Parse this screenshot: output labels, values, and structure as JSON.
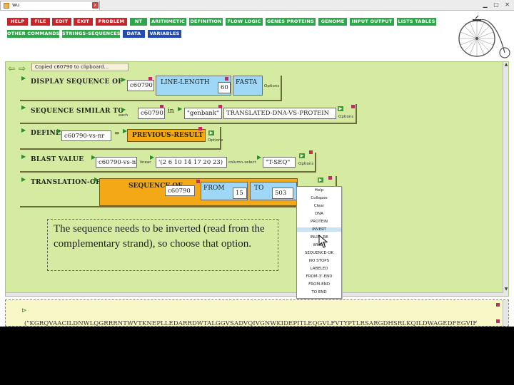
{
  "window": {
    "tab_title": "wu",
    "tab_close": "x"
  },
  "menu": [
    {
      "label": "HELP",
      "color": "#c9262b"
    },
    {
      "label": "FILE",
      "color": "#c9262b"
    },
    {
      "label": "EDIT",
      "color": "#c9262b"
    },
    {
      "label": "EXIT",
      "color": "#c9262b"
    },
    {
      "label": "PROBLEM",
      "color": "#c9262b"
    },
    {
      "label": "NT",
      "color": "#2fa64a"
    },
    {
      "label": "ARITHMETIC",
      "color": "#2fa64a"
    },
    {
      "label": "DEFINITION",
      "color": "#2fa64a"
    },
    {
      "label": "FLOW LOGIC",
      "color": "#2fa64a"
    },
    {
      "label": "GENES PROTEINS",
      "color": "#2fa64a"
    },
    {
      "label": "GENOME",
      "color": "#2fa64a"
    },
    {
      "label": "INPUT OUTPUT",
      "color": "#2fa64a"
    },
    {
      "label": "LISTS TABLES",
      "color": "#2fa64a"
    },
    {
      "label": "OTHER COMMANDS",
      "color": "#2fa64a"
    },
    {
      "label": "STRINGS-SEQUENCES",
      "color": "#2fa64a"
    },
    {
      "label": "DATA",
      "color": "#234bb0"
    },
    {
      "label": "VARIABLES",
      "color": "#234bb0"
    }
  ],
  "clipboard": "Copied c60790 to clipboard...",
  "blocks": {
    "display": {
      "label": "DISPLAY SEQUENCE OF",
      "arg": "c60790",
      "keyword": "LINE-LENGTH",
      "line_length": "60",
      "fasta": "FASTA",
      "options": "Options"
    },
    "similar": {
      "label": "SEQUENCE SIMILAR TO",
      "each": "each",
      "arg": "c60790",
      "in": "in",
      "db": "\"genbank\"",
      "mode": "TRANSLATED-DNA-VS-PROTEIN",
      "options": "Options"
    },
    "define": {
      "label": "DEFINE",
      "var": "c60790-vs-nr",
      "eq": "=",
      "value": "PREVIOUS-RESULT",
      "options": "Options"
    },
    "blast": {
      "label": "BLAST VALUE",
      "arg": "c60790-vs-nr",
      "linear": "linear",
      "list": "'(2 6 10 14 17 20 23)",
      "columnsel": "column-select",
      "qstr": "\"T-SEQ\"",
      "options": "Options"
    },
    "translation": {
      "label": "TRANSLATION-OF",
      "seq_label": "SEQUENCE OF",
      "arg": "c60790",
      "from_label": "FROM",
      "from_val": "15",
      "to_label": "TO",
      "to_val": "503"
    }
  },
  "note": "The sequence needs to be inverted (read from the complementary strand), so choose that option.",
  "context_menu": [
    "Help",
    "Collapse",
    "Clear",
    "DNA",
    "PROTEIN",
    "INVERT",
    "INLIN..RE",
    "WHEN",
    "SEQUENCE-OK",
    "NO STOPS",
    "LABELED",
    "FROM-3'-END",
    "FROM-END",
    "TO END"
  ],
  "context_menu_highlight": 5,
  "output": {
    "prompt": "⊳",
    "text": "(\"KGRQVAACILDNWLQGRRRNTWVTKNEPLLEDARRDWTALGGVSADVQIVGNWKIDEPITLEQGVLFVTYPTLRSARGDHSRLKQILDWAGEDFEGVIF"
  }
}
